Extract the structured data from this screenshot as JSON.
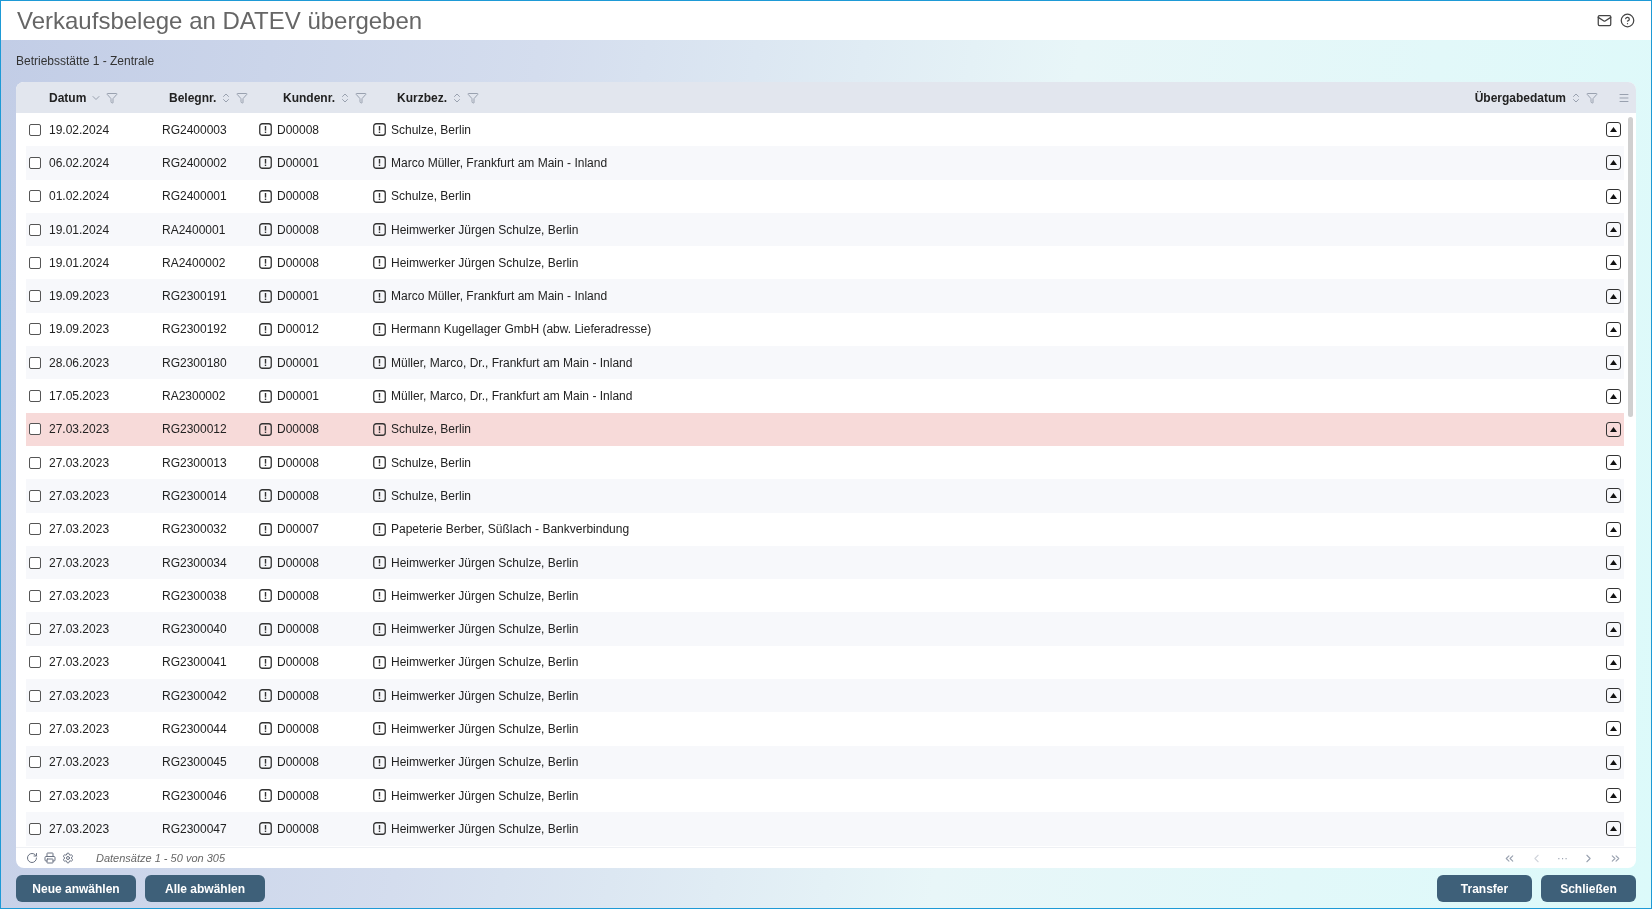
{
  "title": "Verkaufsbelege an DATEV übergeben",
  "subtitle": "Betriebsstätte 1 - Zentrale",
  "columns": [
    {
      "label": "Datum",
      "sorted": true
    },
    {
      "label": "Belegnr.",
      "sorted": false
    },
    {
      "label": "Kundenr.",
      "sorted": false
    },
    {
      "label": "Kurzbez.",
      "sorted": false
    },
    {
      "label": "Übergabedatum",
      "sorted": false
    }
  ],
  "rows": [
    {
      "date": "19.02.2024",
      "doc_no": "RG2400003",
      "customer_no": "D00008",
      "short_name": "Schulze, Berlin",
      "checked": false,
      "flagged": false
    },
    {
      "date": "06.02.2024",
      "doc_no": "RG2400002",
      "customer_no": "D00001",
      "short_name": "Marco Müller, Frankfurt am Main - Inland",
      "checked": false,
      "flagged": false
    },
    {
      "date": "01.02.2024",
      "doc_no": "RG2400001",
      "customer_no": "D00008",
      "short_name": "Schulze, Berlin",
      "checked": false,
      "flagged": false
    },
    {
      "date": "19.01.2024",
      "doc_no": "RA2400001",
      "customer_no": "D00008",
      "short_name": "Heimwerker Jürgen Schulze, Berlin",
      "checked": false,
      "flagged": false
    },
    {
      "date": "19.01.2024",
      "doc_no": "RA2400002",
      "customer_no": "D00008",
      "short_name": "Heimwerker Jürgen Schulze, Berlin",
      "checked": false,
      "flagged": false
    },
    {
      "date": "19.09.2023",
      "doc_no": "RG2300191",
      "customer_no": "D00001",
      "short_name": "Marco Müller, Frankfurt am Main - Inland",
      "checked": false,
      "flagged": false
    },
    {
      "date": "19.09.2023",
      "doc_no": "RG2300192",
      "customer_no": "D00012",
      "short_name": "Hermann Kugellager GmbH (abw. Lieferadresse)",
      "checked": false,
      "flagged": false
    },
    {
      "date": "28.06.2023",
      "doc_no": "RG2300180",
      "customer_no": "D00001",
      "short_name": "Müller, Marco, Dr., Frankfurt am Main - Inland",
      "checked": false,
      "flagged": false
    },
    {
      "date": "17.05.2023",
      "doc_no": "RA2300002",
      "customer_no": "D00001",
      "short_name": "Müller, Marco, Dr., Frankfurt am Main - Inland",
      "checked": false,
      "flagged": false
    },
    {
      "date": "27.03.2023",
      "doc_no": "RG2300012",
      "customer_no": "D00008",
      "short_name": "Schulze, Berlin",
      "checked": false,
      "flagged": true
    },
    {
      "date": "27.03.2023",
      "doc_no": "RG2300013",
      "customer_no": "D00008",
      "short_name": "Schulze, Berlin",
      "checked": false,
      "flagged": false
    },
    {
      "date": "27.03.2023",
      "doc_no": "RG2300014",
      "customer_no": "D00008",
      "short_name": "Schulze, Berlin",
      "checked": false,
      "flagged": false
    },
    {
      "date": "27.03.2023",
      "doc_no": "RG2300032",
      "customer_no": "D00007",
      "short_name": "Papeterie Berber, Süßlach - Bankverbindung",
      "checked": false,
      "flagged": false
    },
    {
      "date": "27.03.2023",
      "doc_no": "RG2300034",
      "customer_no": "D00008",
      "short_name": "Heimwerker Jürgen Schulze, Berlin",
      "checked": false,
      "flagged": false
    },
    {
      "date": "27.03.2023",
      "doc_no": "RG2300038",
      "customer_no": "D00008",
      "short_name": "Heimwerker Jürgen Schulze, Berlin",
      "checked": false,
      "flagged": false
    },
    {
      "date": "27.03.2023",
      "doc_no": "RG2300040",
      "customer_no": "D00008",
      "short_name": "Heimwerker Jürgen Schulze, Berlin",
      "checked": false,
      "flagged": false
    },
    {
      "date": "27.03.2023",
      "doc_no": "RG2300041",
      "customer_no": "D00008",
      "short_name": "Heimwerker Jürgen Schulze, Berlin",
      "checked": false,
      "flagged": false
    },
    {
      "date": "27.03.2023",
      "doc_no": "RG2300042",
      "customer_no": "D00008",
      "short_name": "Heimwerker Jürgen Schulze, Berlin",
      "checked": false,
      "flagged": false
    },
    {
      "date": "27.03.2023",
      "doc_no": "RG2300044",
      "customer_no": "D00008",
      "short_name": "Heimwerker Jürgen Schulze, Berlin",
      "checked": false,
      "flagged": false
    },
    {
      "date": "27.03.2023",
      "doc_no": "RG2300045",
      "customer_no": "D00008",
      "short_name": "Heimwerker Jürgen Schulze, Berlin",
      "checked": false,
      "flagged": false
    },
    {
      "date": "27.03.2023",
      "doc_no": "RG2300046",
      "customer_no": "D00008",
      "short_name": "Heimwerker Jürgen Schulze, Berlin",
      "checked": false,
      "flagged": false
    },
    {
      "date": "27.03.2023",
      "doc_no": "RG2300047",
      "customer_no": "D00008",
      "short_name": "Heimwerker Jürgen Schulze, Berlin",
      "checked": false,
      "flagged": false
    }
  ],
  "record_info": "Datensätze 1 - 50 von 305",
  "pagination_ellipsis": "···",
  "left_buttons": [
    "Neue anwählen",
    "Alle abwählen"
  ],
  "right_buttons": [
    "Transfer",
    "Schließen"
  ]
}
